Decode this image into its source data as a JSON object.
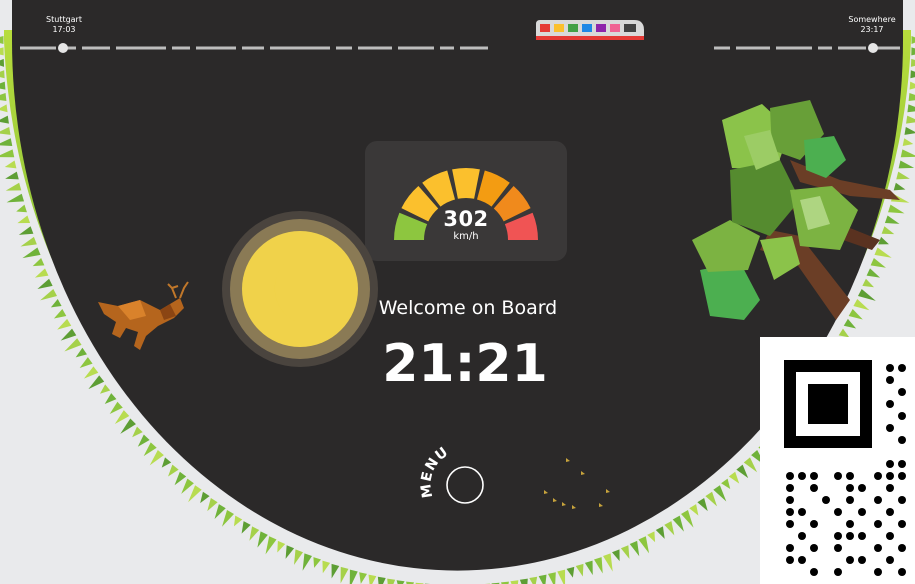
{
  "route": {
    "origin": {
      "city": "Stuttgart",
      "time": "17:03"
    },
    "destination": {
      "city": "Somewhere",
      "time": "23:17"
    },
    "progress": 0.41
  },
  "speedometer": {
    "value": "302",
    "unit": "km/h",
    "colors": [
      "#8dc63f",
      "#fbc02d",
      "#fbc02d",
      "#fbc02d",
      "#f39c12",
      "#f08a1c",
      "#f05454"
    ]
  },
  "welcome_text": "Welcome on Board",
  "clock": "21:21",
  "menu": {
    "label": "MENU"
  },
  "colors": {
    "background": "#e9eaec",
    "panel": "#2b2929",
    "gauge_panel": "#3a3838",
    "grass": "#8dc63f",
    "sun": "#f0d24a",
    "moon": "#ffe600"
  },
  "icons": [
    "sun-moon-icon",
    "deer-icon",
    "tree-icon",
    "birds-icon",
    "train-icon",
    "qr-code-icon"
  ]
}
